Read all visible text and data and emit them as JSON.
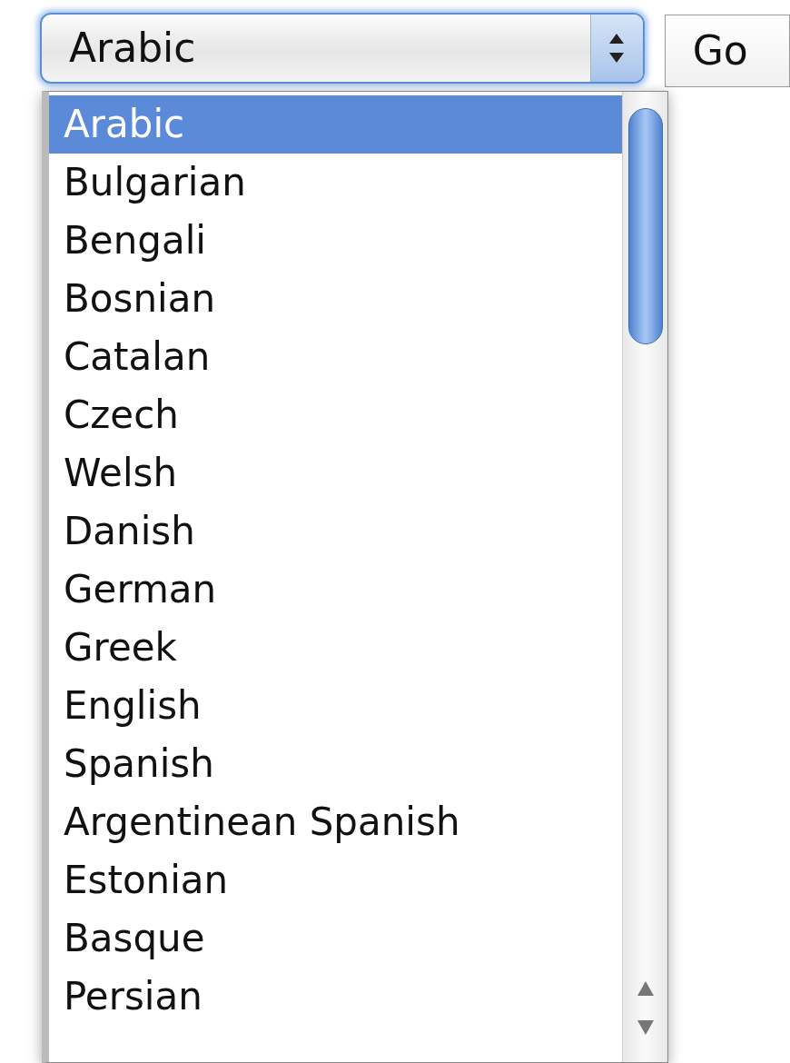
{
  "language_select": {
    "value": "Arabic",
    "expanded": true
  },
  "go_button": {
    "label": "Go"
  },
  "options": [
    {
      "label": "Arabic",
      "selected": true
    },
    {
      "label": "Bulgarian",
      "selected": false
    },
    {
      "label": "Bengali",
      "selected": false
    },
    {
      "label": "Bosnian",
      "selected": false
    },
    {
      "label": "Catalan",
      "selected": false
    },
    {
      "label": "Czech",
      "selected": false
    },
    {
      "label": "Welsh",
      "selected": false
    },
    {
      "label": "Danish",
      "selected": false
    },
    {
      "label": "German",
      "selected": false
    },
    {
      "label": "Greek",
      "selected": false
    },
    {
      "label": "English",
      "selected": false
    },
    {
      "label": "Spanish",
      "selected": false
    },
    {
      "label": "Argentinean Spanish",
      "selected": false
    },
    {
      "label": "Estonian",
      "selected": false
    },
    {
      "label": "Basque",
      "selected": false
    },
    {
      "label": "Persian",
      "selected": false
    }
  ]
}
